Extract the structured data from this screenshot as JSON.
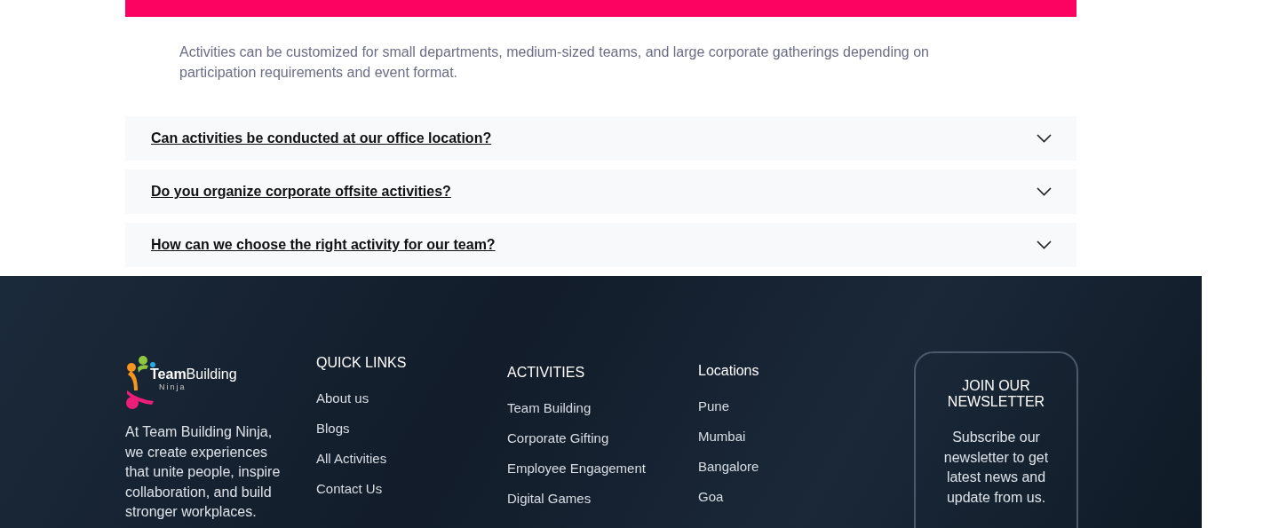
{
  "faq": {
    "items": [
      {
        "expanded": true,
        "answer": "Activities can be customized for small departments, medium-sized teams, and large corporate gatherings depending on participation requirements and event format."
      },
      {
        "expanded": false,
        "question": "Can activities be conducted at our office location?"
      },
      {
        "expanded": false,
        "question": "Do you organize corporate offsite activities?"
      },
      {
        "expanded": false,
        "question": "How can we choose the right activity for our team?"
      }
    ]
  },
  "footer": {
    "logo": {
      "word_bold": "Team",
      "word_light": "Building",
      "tagline": "Ninja"
    },
    "about": "At Team Building Ninja, we create experiences that unite people, inspire collaboration, and build stronger workplaces.",
    "columns": [
      {
        "heading": "QUICK LINKS",
        "links": [
          "About us",
          "Blogs",
          "All Activities",
          "Contact Us"
        ]
      },
      {
        "heading": "ACTIVITIES",
        "links": [
          "Team Building",
          "Corporate Gifting",
          "Employee Engagement",
          "Digital Games"
        ]
      },
      {
        "heading": "Locations",
        "links": [
          "Pune",
          "Mumbai",
          "Bangalore",
          "Goa"
        ]
      }
    ],
    "newsletter": {
      "title": "JOIN OUR NEWSLETTER",
      "text": "Subscribe our newsletter to get latest news and update from us."
    }
  }
}
